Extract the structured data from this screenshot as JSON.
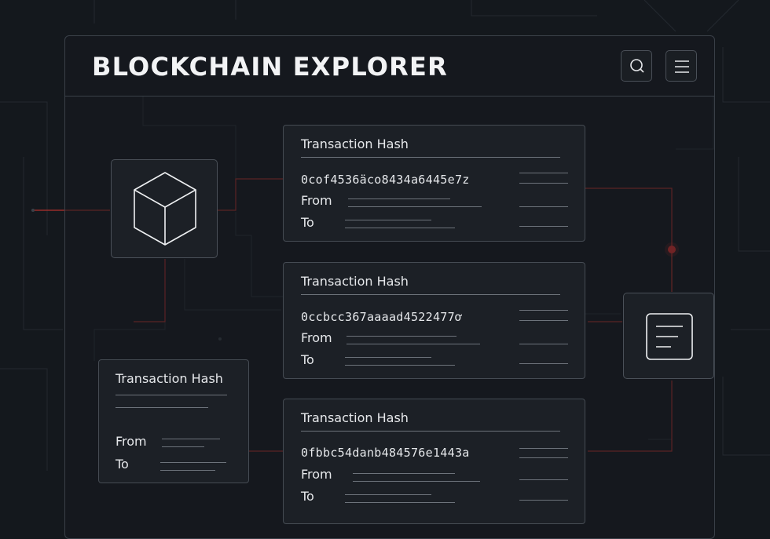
{
  "header": {
    "title": "BLOCKCHAIN EXPLORER",
    "search_icon": "search-icon",
    "menu_icon": "menu-icon"
  },
  "transactions": [
    {
      "label": "Transaction Hash",
      "hash": "0cof4536äco8434a6445e7z",
      "from_label": "From",
      "to_label": "To"
    },
    {
      "label": "Transaction Hash",
      "hash": "0ccbcc367aaaad4522477ơ",
      "from_label": "From",
      "to_label": "To"
    },
    {
      "label": "Transaction Hash",
      "hash": "0fbbc54danb484576e1443a",
      "from_label": "From",
      "to_label": "To"
    }
  ],
  "side_card": {
    "label": "Transaction Hash",
    "from_label": "From",
    "to_label": "To"
  },
  "nodes": {
    "block_icon": "cube-icon",
    "document_icon": "document-icon"
  },
  "colors": {
    "background": "#14181d",
    "accent": "#e0302e",
    "border": "#454b53"
  }
}
